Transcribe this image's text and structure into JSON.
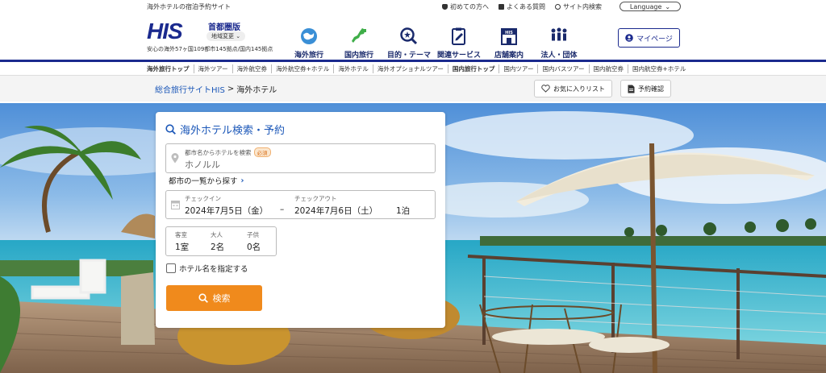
{
  "topbar": {
    "site_desc": "海外ホテルの宿泊予約サイト",
    "links": [
      "初めての方へ",
      "よくある質問",
      "サイト内検索"
    ],
    "language": "Language"
  },
  "header": {
    "logo": "HIS",
    "region": "首都圏版",
    "region_change": "地域変更",
    "tagline": "安心の海外57ヶ国109都市145拠点/国内145拠点",
    "nav": [
      "海外旅行",
      "国内旅行",
      "目的・テーマ",
      "関連サービス",
      "店舗案内",
      "法人・団体"
    ],
    "mypage": "マイページ"
  },
  "subnav": [
    "海外旅行トップ",
    "海外ツアー",
    "海外航空券",
    "海外航空券+ホテル",
    "海外ホテル",
    "海外オプショナルツアー",
    "国内旅行トップ",
    "国内ツアー",
    "国内バスツアー",
    "国内航空券",
    "国内航空券+ホテル"
  ],
  "breadcrumb": {
    "home": "総合旅行サイトHIS",
    "sep": ">",
    "current": "海外ホテル",
    "favorites": "お気に入りリスト",
    "reservation": "予約確認"
  },
  "search": {
    "title": "海外ホテル検索・予約",
    "city_label": "都市名からホテルを検索",
    "required": "必須",
    "city_value": "ホノルル",
    "city_list_link": "都市の一覧から探す",
    "checkin_label": "チェックイン",
    "checkin_value": "2024年7月5日（金）",
    "dash": "–",
    "checkout_label": "チェックアウト",
    "checkout_value": "2024年7月6日（土）",
    "nights": "1泊",
    "rooms_label": "客室",
    "rooms_value": "1室",
    "adults_label": "大人",
    "adults_value": "2名",
    "children_label": "子供",
    "children_value": "0名",
    "hotel_name_check": "ホテル名を指定する",
    "search_button": "検索"
  },
  "colors": {
    "brand": "#1b2a8e",
    "accent": "#f08a1c",
    "link": "#1b57b8"
  }
}
